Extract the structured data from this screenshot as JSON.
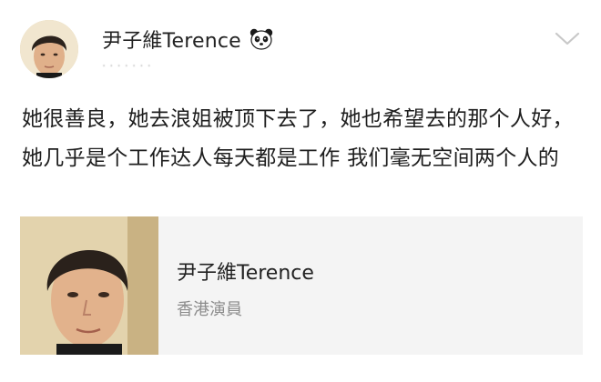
{
  "post": {
    "author": {
      "name": "尹子維Terence",
      "badge_icon": "panda-icon"
    },
    "meta": "· · · · · · ·",
    "text": "她很善良，她去浪姐被顶下去了，她也希望去的那个人好，她几乎是个工作达人每天都是工作 我们毫无空间两个人的"
  },
  "card": {
    "name": "尹子維Terence",
    "subtitle": "香港演員"
  },
  "colors": {
    "card_background": "#f4f4f4",
    "subtitle_gray": "#8c8c8c",
    "chevron_gray": "#c8c8c8"
  },
  "icons": {
    "more": "chevron-down-icon",
    "badge": "panda-icon"
  }
}
